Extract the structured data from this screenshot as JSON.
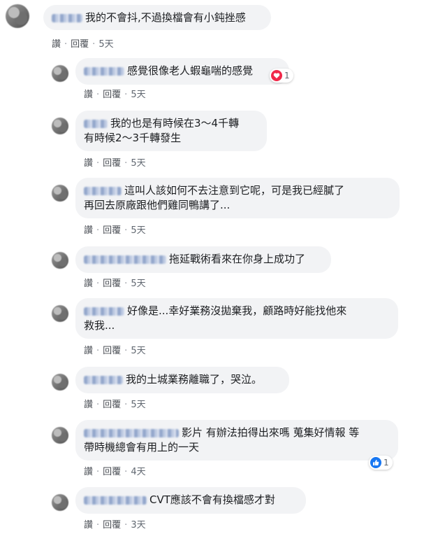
{
  "actions": {
    "like_label": "讚",
    "reply_label": "回覆",
    "separator": "·"
  },
  "comments": [
    {
      "text": "我的不會抖,不過換檔會有小鈍挫感",
      "time": "5天"
    },
    {
      "text": "感覺很像老人蝦龜喘的感覺",
      "time": "5天",
      "reaction": {
        "icon": "heart-icon",
        "count": "1",
        "color": "#f0284a"
      }
    },
    {
      "line1": "我的也是有時候在3～4千轉",
      "line2": "有時候2～3千轉發生",
      "time": "5天"
    },
    {
      "line1": "這叫人該如何不去注意到它呢，可是我已經膩了",
      "line2": "再回去原廠跟他們雞同鴨講了...",
      "time": "5天"
    },
    {
      "text": "拖延戰術看來在你身上成功了",
      "time": "5天"
    },
    {
      "line1": "好像是...幸好業務沒拋棄我，顧路時好能找他來",
      "line2": "救我...",
      "time": "5天"
    },
    {
      "text": "我的土城業務離職了，哭泣。",
      "time": "5天"
    },
    {
      "line1": "影片 有辦法拍得出來嗎 蒐集好情報 等",
      "line2": "帶時機總會有用上的一天",
      "time": "4天",
      "reaction": {
        "icon": "thumbs-up-icon",
        "count": "1",
        "color": "#1877f2"
      }
    },
    {
      "text": "CVT應該不會有換檔感才對",
      "time": "3天"
    }
  ]
}
